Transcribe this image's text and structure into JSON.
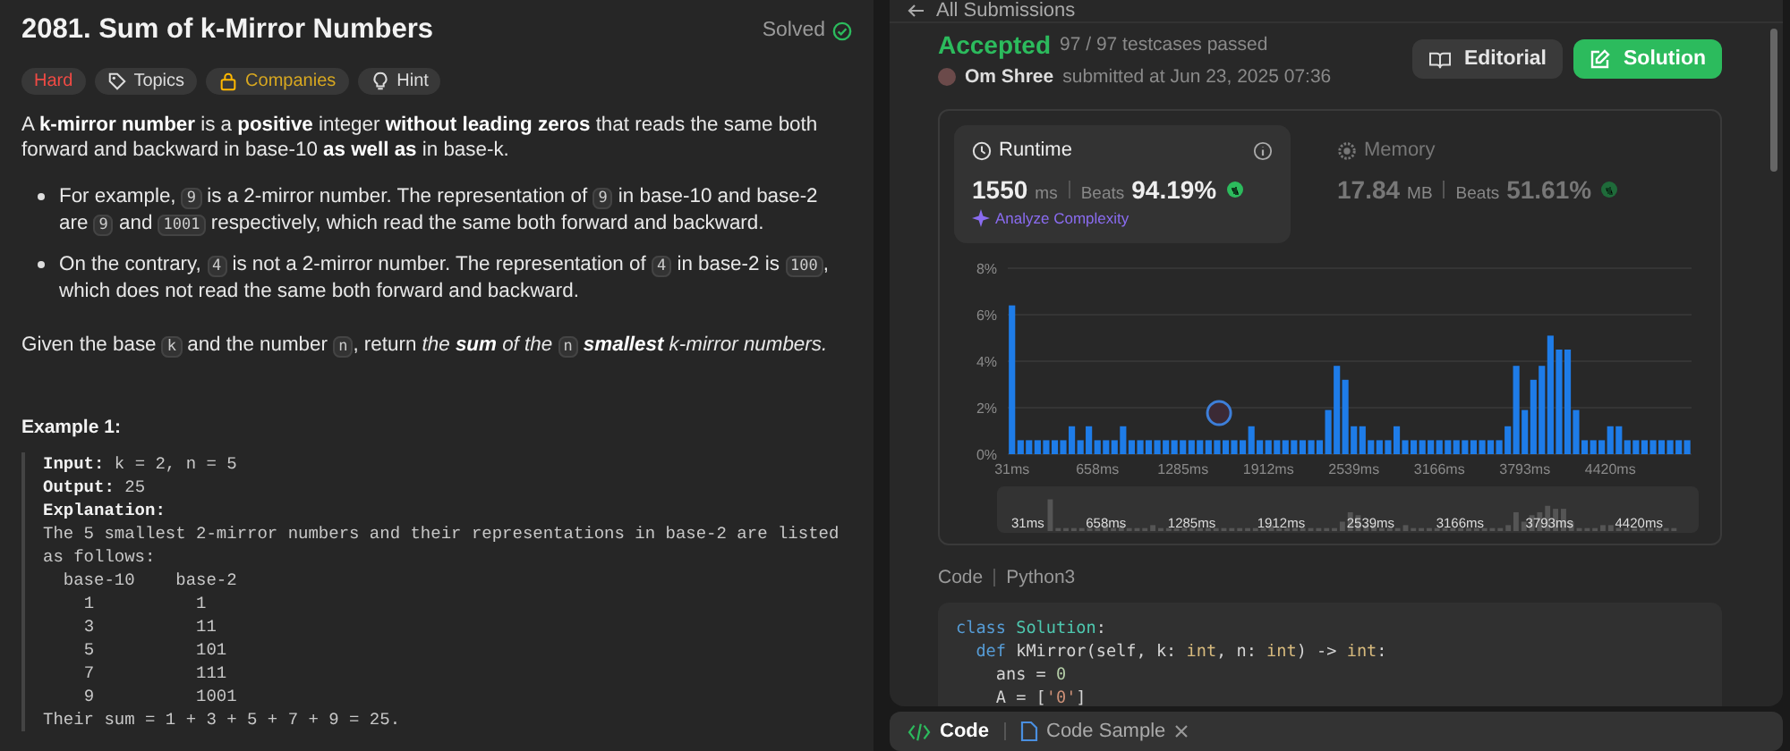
{
  "problem": {
    "title": "2081. Sum of k-Mirror Numbers",
    "solved_label": "Solved",
    "tags": [
      {
        "label": "Hard",
        "kind": "difficulty"
      },
      {
        "label": "Topics",
        "kind": "topics"
      },
      {
        "label": "Companies",
        "kind": "companies"
      },
      {
        "label": "Hint",
        "kind": "hint"
      }
    ],
    "intro": [
      {
        "kind": "text",
        "text": "A **k-mirror number** is a **positive** integer **without leading zeros** that reads the same both forward and backward in base-10 **as well as** in base-k."
      }
    ],
    "bullets": [
      [
        {
          "kind": "text",
          "text": "For example, "
        },
        {
          "kind": "code",
          "text": "9"
        },
        {
          "kind": "text",
          "text": " is a 2-mirror number. The representation of "
        },
        {
          "kind": "code",
          "text": "9"
        },
        {
          "kind": "text",
          "text": " in base-10 and base-2 are "
        },
        {
          "kind": "code",
          "text": "9"
        },
        {
          "kind": "text",
          "text": " and "
        },
        {
          "kind": "code",
          "text": "1001"
        },
        {
          "kind": "text",
          "text": " respectively, which read the same both forward and backward."
        }
      ],
      [
        {
          "kind": "text",
          "text": "On the contrary, "
        },
        {
          "kind": "code",
          "text": "4"
        },
        {
          "kind": "text",
          "text": " is not a 2-mirror number. The representation of "
        },
        {
          "kind": "code",
          "text": "4"
        },
        {
          "kind": "text",
          "text": " in base-2 is "
        },
        {
          "kind": "code",
          "text": "100"
        },
        {
          "kind": "text",
          "text": ", which does not read the same both forward and backward."
        }
      ]
    ],
    "closing": [
      {
        "kind": "text",
        "text": "Given the base "
      },
      {
        "kind": "code",
        "text": "k"
      },
      {
        "kind": "text",
        "text": " and the number "
      },
      {
        "kind": "code",
        "text": "n"
      },
      {
        "kind": "text",
        "text": ", return "
      },
      {
        "kind": "em",
        "text": "the **sum** of the "
      },
      {
        "kind": "code",
        "text": "n"
      },
      {
        "kind": "em",
        "text": " **smallest** k-mirror numbers."
      }
    ],
    "example": {
      "title": "Example 1:",
      "lines": [
        "**Input:** k = 2, n = 5",
        "**Output:** 25",
        "**Explanation:**",
        "The 5 smallest 2-mirror numbers and their representations in base-2 are listed as follows:",
        "  base-10    base-2",
        "    1          1",
        "    3          11",
        "    5          101",
        "    7          111",
        "    9          1001",
        "Their sum = 1 + 3 + 5 + 7 + 9 = 25."
      ]
    }
  },
  "submission": {
    "back_link": "All Submissions",
    "status": "Accepted",
    "testcases": "97 / 97 testcases passed",
    "author": "Om Shree",
    "submitted": "submitted at Jun 23, 2025 07:36",
    "buttons": [
      {
        "label": "Editorial",
        "kind": "secondary"
      },
      {
        "label": "Solution",
        "kind": "primary"
      }
    ],
    "metrics": [
      {
        "kind": "runtime",
        "label": "Runtime",
        "selected": true,
        "value": "1550",
        "unit": "ms",
        "beats_label": "Beats",
        "beats": "94.19%",
        "link": "Analyze Complexity"
      },
      {
        "kind": "memory",
        "label": "Memory",
        "selected": false,
        "value": "17.84",
        "unit": "MB",
        "beats_label": "Beats",
        "beats": "51.61%"
      }
    ],
    "chart_data": {
      "type": "bar",
      "grid": true,
      "xlim": [
        0,
        5016
      ],
      "ylim": [
        0,
        8
      ],
      "yticks": [
        {
          "value": 0,
          "label": "0%"
        },
        {
          "value": 2,
          "label": "2%"
        },
        {
          "value": 4,
          "label": "4%"
        },
        {
          "value": 6,
          "label": "6%"
        },
        {
          "value": 8,
          "label": "8%"
        }
      ],
      "xticks": [
        {
          "value": 31,
          "label": "31ms"
        },
        {
          "value": 658,
          "label": "658ms"
        },
        {
          "value": 1285,
          "label": "1285ms"
        },
        {
          "value": 1912,
          "label": "1912ms"
        },
        {
          "value": 2539,
          "label": "2539ms"
        },
        {
          "value": 3166,
          "label": "3166ms"
        },
        {
          "value": 3793,
          "label": "3793ms"
        },
        {
          "value": 4420,
          "label": "4420ms"
        }
      ],
      "x": [
        31,
        94,
        156,
        219,
        282,
        345,
        407,
        470,
        533,
        595,
        658,
        721,
        783,
        846,
        909,
        972,
        1034,
        1097,
        1160,
        1222,
        1285,
        1348,
        1410,
        1473,
        1536,
        1599,
        1661,
        1724,
        1787,
        1849,
        1912,
        1975,
        2037,
        2100,
        2163,
        2226,
        2288,
        2351,
        2414,
        2476,
        2539,
        2602,
        2664,
        2727,
        2790,
        2853,
        2915,
        2978,
        3041,
        3103,
        3166,
        3229,
        3291,
        3354,
        3417,
        3480,
        3542,
        3605,
        3668,
        3730,
        3793,
        3856,
        3918,
        3981,
        4044,
        4107,
        4169,
        4232,
        4295,
        4357,
        4420,
        4483,
        4545,
        4608,
        4671,
        4734,
        4796,
        4859,
        4922,
        4984
      ],
      "series": [
        {
          "color": "#1e7ce8",
          "values": [
            6.4,
            0.6,
            0.6,
            0.6,
            0.6,
            0.6,
            0.6,
            1.2,
            0.6,
            1.2,
            0.6,
            0.6,
            0.6,
            1.2,
            0.6,
            0.6,
            0.6,
            0.6,
            0.6,
            0.6,
            0.6,
            0.6,
            0.6,
            0.6,
            0.6,
            0.6,
            0.6,
            0.6,
            1.2,
            0.6,
            0.6,
            0.6,
            0.6,
            0.6,
            0.6,
            0.6,
            0.6,
            1.9,
            3.8,
            3.2,
            1.2,
            1.2,
            0.6,
            0.6,
            0.6,
            1.2,
            0.6,
            0.6,
            0.6,
            0.6,
            0.6,
            0.6,
            0.6,
            0.6,
            0.6,
            0.6,
            0.6,
            0.6,
            1.2,
            3.8,
            1.9,
            3.2,
            3.8,
            5.1,
            4.5,
            4.5,
            1.9,
            0.6,
            0.6,
            0.6,
            1.2,
            1.2,
            0.6,
            0.6,
            0.6,
            0.6,
            0.6,
            0.6,
            0.6,
            0.6
          ]
        }
      ]
    },
    "overview_labels": [
      "31ms",
      "658ms",
      "1285ms",
      "1912ms",
      "2539ms",
      "3166ms",
      "3793ms",
      "4420ms"
    ],
    "code_label": "Code",
    "language": "Python3",
    "code_lines": [
      [
        {
          "t": "class ",
          "kind": "keyword"
        },
        {
          "t": "Solution",
          "kind": "class"
        },
        {
          "t": ":",
          "kind": "plain"
        }
      ],
      [
        {
          "t": "  def",
          "kind": "keyword"
        },
        {
          "t": " kMirror(self, k: ",
          "kind": "plain"
        },
        {
          "t": "int",
          "kind": "type"
        },
        {
          "t": ", n: ",
          "kind": "plain"
        },
        {
          "t": "int",
          "kind": "type"
        },
        {
          "t": ") -> ",
          "kind": "plain"
        },
        {
          "t": "int",
          "kind": "type"
        },
        {
          "t": ":",
          "kind": "plain"
        }
      ],
      [
        {
          "t": "    ans = ",
          "kind": "plain"
        },
        {
          "t": "0",
          "kind": "number"
        }
      ],
      [
        {
          "t": "    A = [",
          "kind": "plain"
        },
        {
          "t": "'0'",
          "kind": "string"
        },
        {
          "t": "]",
          "kind": "plain"
        }
      ]
    ]
  },
  "bottom_tabs": [
    {
      "label": "Code",
      "kind": "code",
      "selected": true,
      "closable": false
    },
    {
      "label": "Code Sample",
      "kind": "file",
      "selected": false,
      "closable": true
    }
  ]
}
